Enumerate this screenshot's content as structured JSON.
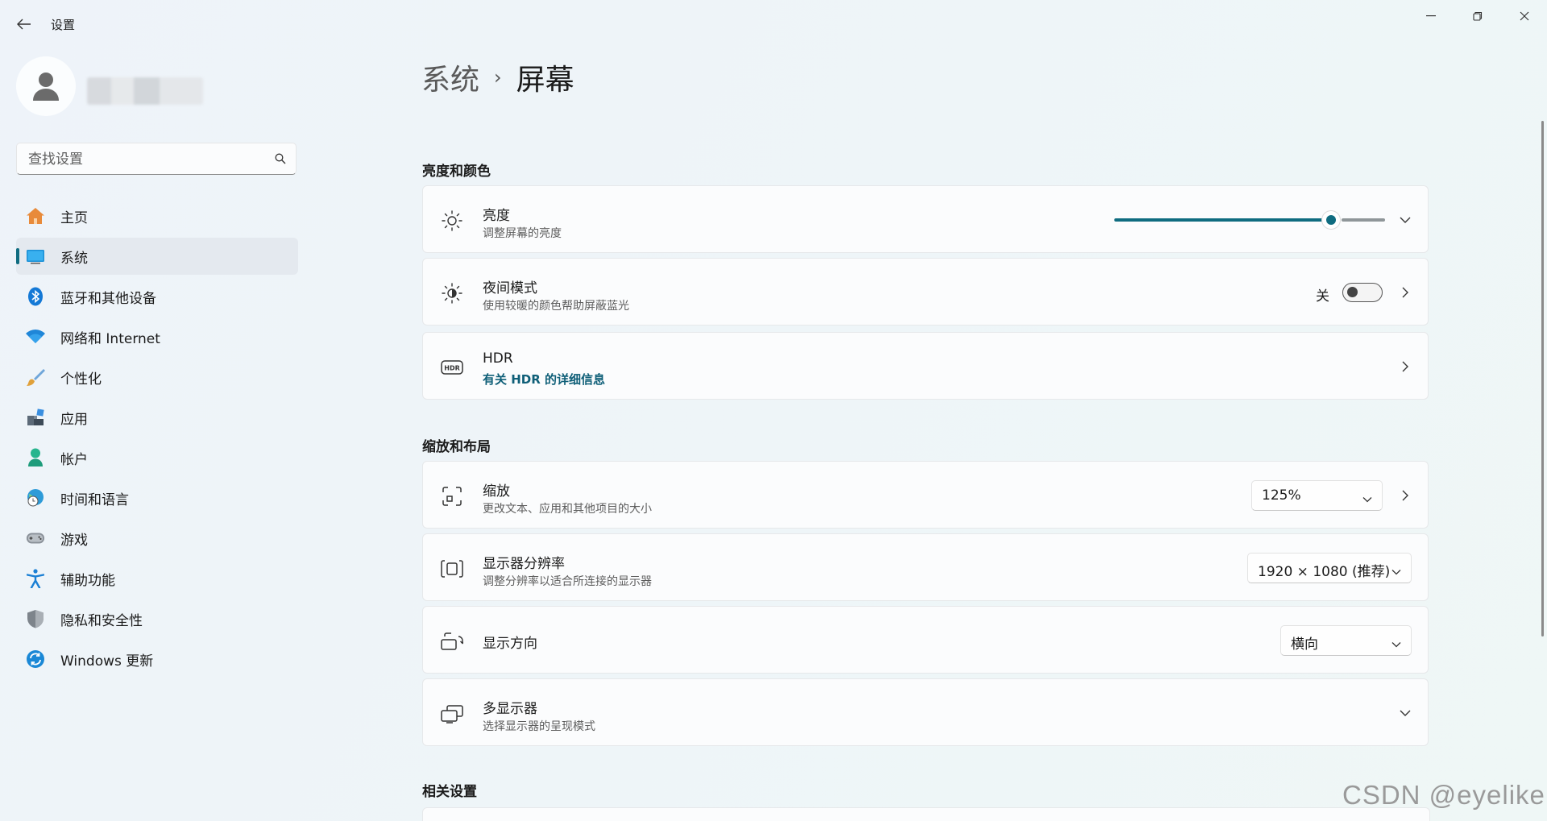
{
  "app": {
    "title": "设置"
  },
  "search": {
    "placeholder": "查找设置"
  },
  "sidebar": {
    "items": [
      {
        "label": "主页",
        "icon": "home-icon"
      },
      {
        "label": "系统",
        "icon": "monitor-icon",
        "active": true
      },
      {
        "label": "蓝牙和其他设备",
        "icon": "bluetooth-icon"
      },
      {
        "label": "网络和 Internet",
        "icon": "wifi-icon"
      },
      {
        "label": "个性化",
        "icon": "brush-icon"
      },
      {
        "label": "应用",
        "icon": "apps-icon"
      },
      {
        "label": "帐户",
        "icon": "account-icon"
      },
      {
        "label": "时间和语言",
        "icon": "globe-clock-icon"
      },
      {
        "label": "游戏",
        "icon": "gamepad-icon"
      },
      {
        "label": "辅助功能",
        "icon": "accessibility-icon"
      },
      {
        "label": "隐私和安全性",
        "icon": "shield-icon"
      },
      {
        "label": "Windows 更新",
        "icon": "update-icon"
      }
    ]
  },
  "breadcrumb": {
    "parent": "系统",
    "separator": "›",
    "current": "屏幕"
  },
  "sections": {
    "brightness_color": "亮度和颜色",
    "scale_layout": "缩放和布局",
    "related": "相关设置"
  },
  "cards": {
    "brightness": {
      "title": "亮度",
      "subtitle": "调整屏幕的亮度",
      "level": 0.8
    },
    "night_light": {
      "title": "夜间模式",
      "subtitle": "使用较暖的颜色帮助屏蔽蓝光",
      "state_label": "关",
      "on": false
    },
    "hdr": {
      "title": "HDR",
      "link": "有关 HDR 的详细信息"
    },
    "scale": {
      "title": "缩放",
      "subtitle": "更改文本、应用和其他项目的大小",
      "value": "125%"
    },
    "resolution": {
      "title": "显示器分辨率",
      "subtitle": "调整分辨率以适合所连接的显示器",
      "value": "1920 × 1080 (推荐)"
    },
    "orientation": {
      "title": "显示方向",
      "value": "横向"
    },
    "multi_display": {
      "title": "多显示器",
      "subtitle": "选择显示器的呈现模式"
    }
  },
  "watermark": "CSDN @eyelike",
  "colors": {
    "accent": "#0f6c80"
  }
}
